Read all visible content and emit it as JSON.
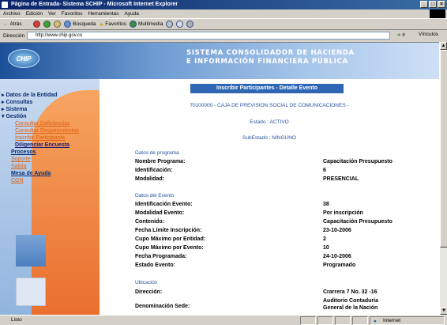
{
  "window": {
    "title": "Página de Entrada- Sistema SCHIP - Microsoft Internet Explorer"
  },
  "menu": [
    "Archivo",
    "Edición",
    "Ver",
    "Favoritos",
    "Herramientas",
    "Ayuda"
  ],
  "toolbar": {
    "back": "Atrás",
    "search": "Búsqueda",
    "favorites": "Favoritos",
    "media": "Multimedia"
  },
  "address": {
    "label": "Dirección",
    "url": "http://www.chip.gov.co",
    "go": "Ir",
    "links": "Vínculos"
  },
  "banner": {
    "logo": "CHIP",
    "line1": "SISTEMA CONSOLIDADOR DE HACIENDA",
    "line2": "E INFORMACIÓN FINANCIERA PÚBLICA"
  },
  "nav": {
    "datos": "Datos de la Entidad",
    "consultas": "Consultas",
    "sistema": "Sistema",
    "gestion": "Gestión",
    "sub1": "Consultar Deficiencias",
    "sub2": "Consultar Requerimientos",
    "sub3": "Inscribir Participante",
    "sub4": "Diligenciar Encuesta",
    "procesos": "Procesos",
    "soporte": "Soporte",
    "salida": "Salida",
    "mesa": "Mesa de Ayuda",
    "cgn": "CGN"
  },
  "content": {
    "header": "Inscribir Participantes - Detalle Evento",
    "entity": "70100000 - CAJA DE PREVISION SOCIAL DE COMUNICACIONES -",
    "estado": "Estado : ACTIVO",
    "subestado": "SubEstado : NINGUNO",
    "sec_programa": "Datos de programa",
    "programa": [
      {
        "l": "Nombre Programa:",
        "v": "Capacitación Presupuesto"
      },
      {
        "l": "Identificación:",
        "v": "6"
      },
      {
        "l": "Modalidad:",
        "v": "PRESENCIAL"
      }
    ],
    "sec_evento": "Datos del Evento",
    "evento": [
      {
        "l": "Identificación Evento:",
        "v": "38"
      },
      {
        "l": "Modalidad Evento:",
        "v": "Por inscripción"
      },
      {
        "l": "Contenido:",
        "v": "Capacitación Presupuesto"
      },
      {
        "l": "Fecha Límite Inscripción:",
        "v": "23-10-2006"
      },
      {
        "l": "Cupo Máximo por Entidad:",
        "v": "2"
      },
      {
        "l": "Cupo Máximo por Evento:",
        "v": "10"
      },
      {
        "l": "Fecha Programada:",
        "v": "24-10-2006"
      },
      {
        "l": "Estado Evento:",
        "v": "Programado"
      }
    ],
    "sec_ubicacion": "Ubicación",
    "direccion": {
      "l": "Dirección:",
      "v": "Crarrera 7 No. 32 -16"
    },
    "sede": {
      "l": "Denominación Sede:",
      "v1": "Auditorio Contaduría",
      "v2": "General de la Nación"
    }
  },
  "status": {
    "left": "Listo",
    "zone": "Internet"
  }
}
